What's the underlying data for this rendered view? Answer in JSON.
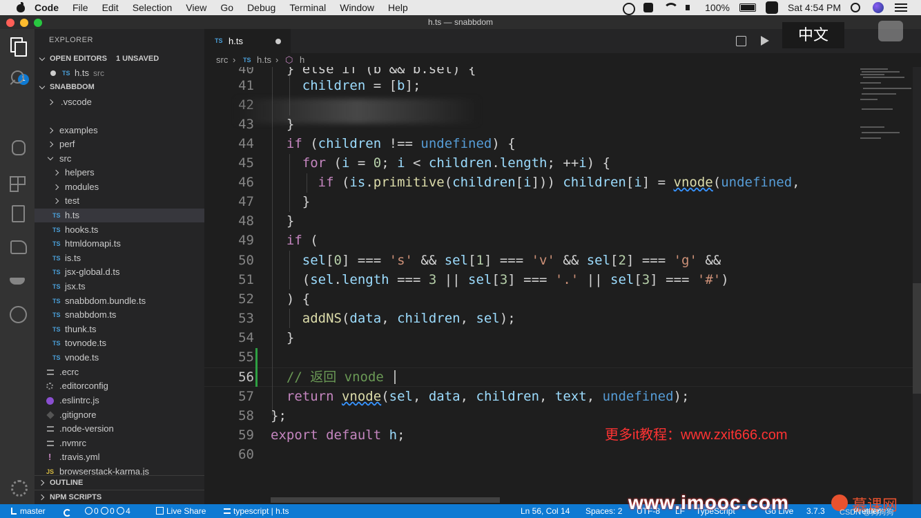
{
  "menubar": {
    "app": "Code",
    "items": [
      "File",
      "Edit",
      "Selection",
      "View",
      "Go",
      "Debug",
      "Terminal",
      "Window",
      "Help"
    ],
    "battery": "100%",
    "clock": "Sat 4:54 PM"
  },
  "window": {
    "title": "h.ts — snabbdom"
  },
  "activity": {
    "explorer_badge": "1"
  },
  "sidebar": {
    "header": "EXPLORER",
    "open_editors": {
      "title": "OPEN EDITORS",
      "unsaved": "1 UNSAVED",
      "files": [
        {
          "name": "h.ts",
          "desc": "src"
        }
      ]
    },
    "project": "SNABBDOM",
    "tree": [
      {
        "label": ".vscode",
        "kind": "folder"
      },
      {
        "label": "examples",
        "kind": "folder"
      },
      {
        "label": "perf",
        "kind": "folder"
      },
      {
        "label": "src",
        "kind": "folder-open"
      },
      {
        "label": "helpers",
        "kind": "folder"
      },
      {
        "label": "modules",
        "kind": "folder"
      },
      {
        "label": "test",
        "kind": "folder"
      },
      {
        "label": "h.ts",
        "kind": "ts"
      },
      {
        "label": "hooks.ts",
        "kind": "ts"
      },
      {
        "label": "htmldomapi.ts",
        "kind": "ts"
      },
      {
        "label": "is.ts",
        "kind": "ts"
      },
      {
        "label": "jsx-global.d.ts",
        "kind": "ts"
      },
      {
        "label": "jsx.ts",
        "kind": "ts"
      },
      {
        "label": "snabbdom.bundle.ts",
        "kind": "ts"
      },
      {
        "label": "snabbdom.ts",
        "kind": "ts"
      },
      {
        "label": "thunk.ts",
        "kind": "ts"
      },
      {
        "label": "tovnode.ts",
        "kind": "ts"
      },
      {
        "label": "vnode.ts",
        "kind": "ts"
      },
      {
        "label": ".ecrc",
        "kind": "lines"
      },
      {
        "label": ".editorconfig",
        "kind": "gear"
      },
      {
        "label": ".eslintrc.js",
        "kind": "eslint"
      },
      {
        "label": ".gitignore",
        "kind": "git"
      },
      {
        "label": ".node-version",
        "kind": "lines"
      },
      {
        "label": ".nvmrc",
        "kind": "lines"
      },
      {
        "label": ".travis.yml",
        "kind": "yml"
      },
      {
        "label": "browserstack-karma.js",
        "kind": "js"
      }
    ],
    "outline": "OUTLINE",
    "npm_scripts": "NPM SCRIPTS"
  },
  "editor": {
    "tab": {
      "label": "h.ts",
      "type_badge": "TS"
    },
    "breadcrumb": {
      "folder": "src",
      "file": "h.ts",
      "symbol": "h"
    },
    "overlay_label": "中文",
    "lines": [
      {
        "n": "40",
        "text": "  } else if (b && b.sel) {"
      },
      {
        "n": "41",
        "text": "    children = [b];"
      },
      {
        "n": "42",
        "text": ""
      },
      {
        "n": "43",
        "text": "  }"
      },
      {
        "n": "44",
        "text": "  if (children !== undefined) {"
      },
      {
        "n": "45",
        "text": "    for (i = 0; i < children.length; ++i) {"
      },
      {
        "n": "46",
        "text": "      if (is.primitive(children[i])) children[i] = vnode(undefined,"
      },
      {
        "n": "47",
        "text": "    }"
      },
      {
        "n": "48",
        "text": "  }"
      },
      {
        "n": "49",
        "text": "  if ("
      },
      {
        "n": "50",
        "text": "    sel[0] === 's' && sel[1] === 'v' && sel[2] === 'g' &&"
      },
      {
        "n": "51",
        "text": "    (sel.length === 3 || sel[3] === '.' || sel[3] === '#')"
      },
      {
        "n": "52",
        "text": "  ) {"
      },
      {
        "n": "53",
        "text": "    addNS(data, children, sel);"
      },
      {
        "n": "54",
        "text": "  }"
      },
      {
        "n": "55",
        "text": ""
      },
      {
        "n": "56",
        "text": "  // 返回 vnode"
      },
      {
        "n": "57",
        "text": "  return vnode(sel, data, children, text, undefined);"
      },
      {
        "n": "58",
        "text": "};"
      },
      {
        "n": "59",
        "text": "export default h;"
      },
      {
        "n": "60",
        "text": ""
      }
    ],
    "watermark": "更多it教程：www.zxit666.com"
  },
  "statusbar": {
    "branch": "master",
    "problems": "0",
    "warnings": "0",
    "info": "4",
    "live_share": "Live Share",
    "lang_ext": "typescript | h.ts",
    "position": "Ln 56, Col 14",
    "spaces": "Spaces: 2",
    "encoding": "UTF-8",
    "eol": "LF",
    "language": "TypeScript",
    "go_live": "Go Live",
    "version": "3.7.3",
    "prettier": "Prettier"
  },
  "watermarks": {
    "imooc": "www.imooc.com",
    "imooc_cn": "慕课网",
    "csdn": "CSDN @狗狗狗"
  },
  "colors": {
    "statusbar": "#0e7ad3",
    "activitybar": "#333333",
    "sidebar": "#252526",
    "editor": "#1e1e1e"
  }
}
